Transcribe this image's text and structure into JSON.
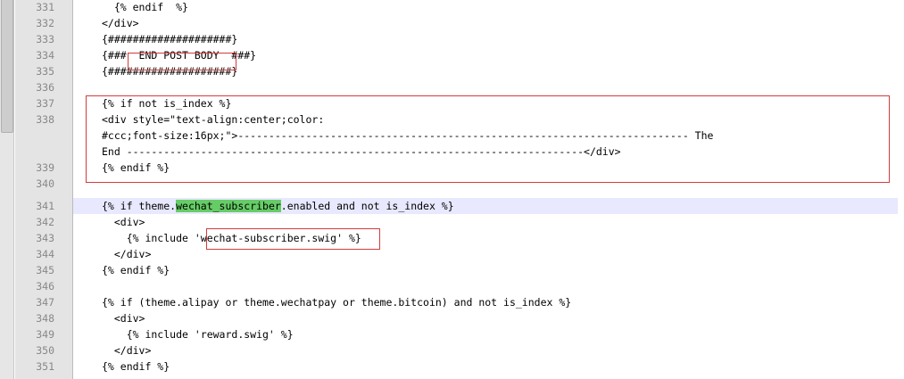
{
  "editor": {
    "current_line": "341",
    "lines": [
      {
        "n": "331",
        "text": "  {% endif  %}"
      },
      {
        "n": "332",
        "text": "</div>"
      },
      {
        "n": "333",
        "text": "{####################}"
      },
      {
        "n": "334",
        "text": "{###  END POST BODY  ###}"
      },
      {
        "n": "335",
        "text": "{####################}"
      },
      {
        "n": "336",
        "text": ""
      },
      {
        "n": "337",
        "text": "{% if not is_index %}"
      },
      {
        "n": "338",
        "text": "<div style=\"text-align:center;color:"
      },
      {
        "n": "",
        "text": "#ccc;font-size:16px;\">------------------------------------------------------------------------- The"
      },
      {
        "n": "",
        "text": "End --------------------------------------------------------------------------</div>"
      },
      {
        "n": "339",
        "text": "{% endif %}"
      },
      {
        "n": "340",
        "text": ""
      },
      {
        "n": "341",
        "pre": "{% if theme.",
        "highlight": "wechat_subscriber",
        "post": ".enabled and not is_index %}"
      },
      {
        "n": "342",
        "text": "  <div>"
      },
      {
        "n": "343",
        "text": "    {% include 'wechat-subscriber.swig' %}"
      },
      {
        "n": "344",
        "text": "  </div>"
      },
      {
        "n": "345",
        "text": "{% endif %}"
      },
      {
        "n": "346",
        "text": ""
      },
      {
        "n": "347",
        "text": "{% if (theme.alipay or theme.wechatpay or theme.bitcoin) and not is_index %}"
      },
      {
        "n": "348",
        "text": "  <div>"
      },
      {
        "n": "349",
        "text": "    {% include 'reward.swig' %}"
      },
      {
        "n": "350",
        "text": "  </div>"
      },
      {
        "n": "351",
        "text": "{% endif %}"
      }
    ]
  },
  "colors": {
    "highlight": "#66cc66",
    "current_line_bg": "#e8e8ff",
    "annotation_border": "#d33c3c"
  }
}
